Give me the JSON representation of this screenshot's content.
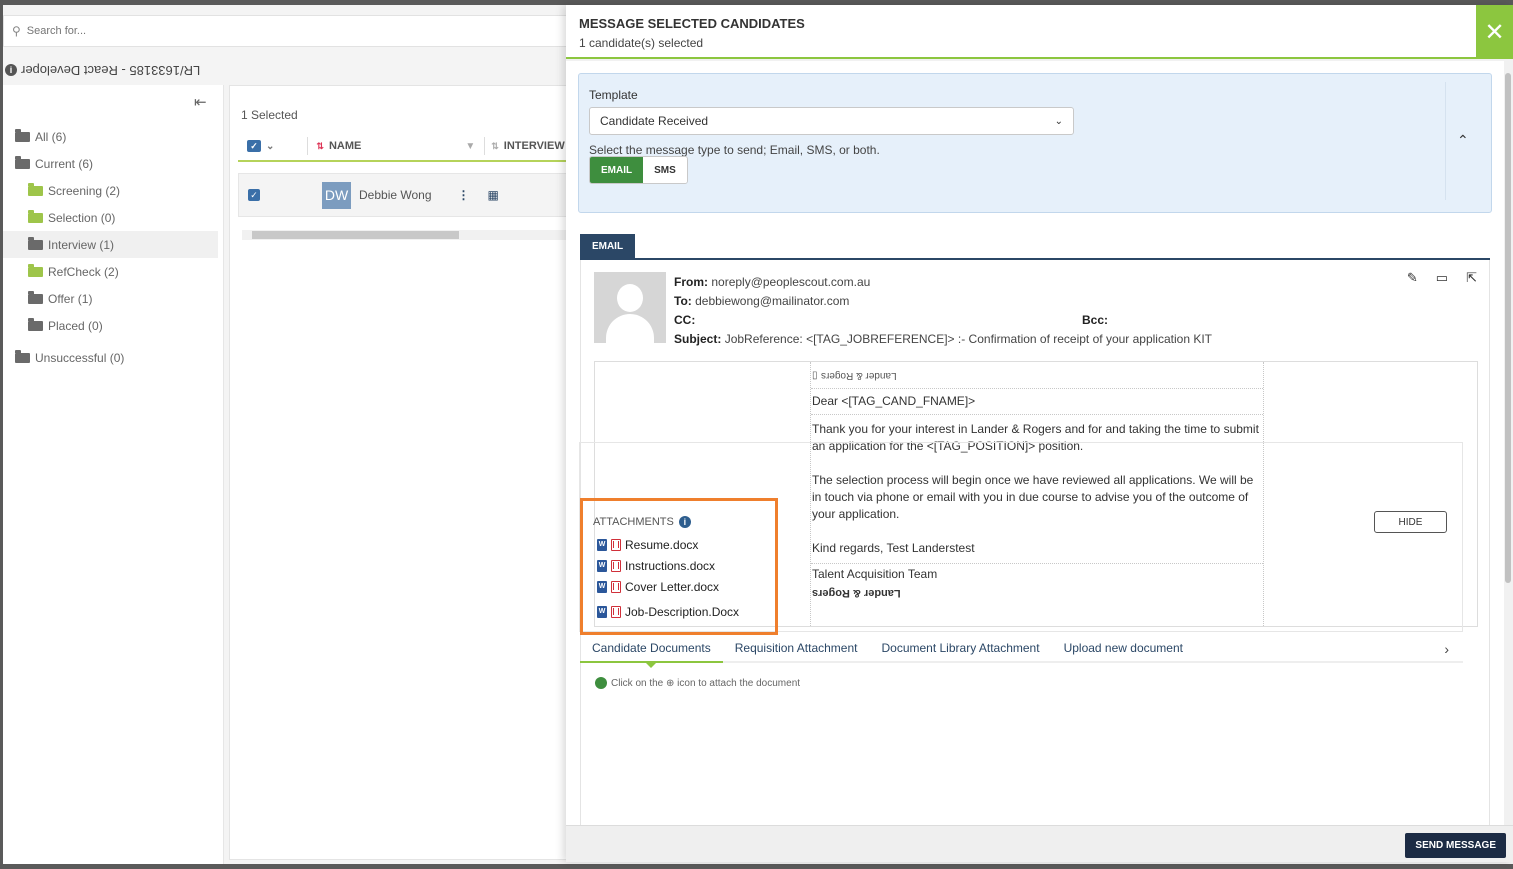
{
  "background": {
    "search_placeholder": "Search for...",
    "job_title": "LR/1633185 - React Developer",
    "folders": [
      {
        "label": "All (6)",
        "level": 0,
        "color": "gray"
      },
      {
        "label": "Current (6)",
        "level": 0,
        "color": "gray"
      },
      {
        "label": "Screening (2)",
        "level": 1,
        "color": "green"
      },
      {
        "label": "Selection (0)",
        "level": 1,
        "color": "green"
      },
      {
        "label": "Interview (1)",
        "level": 1,
        "color": "gray",
        "active": true
      },
      {
        "label": "RefCheck (2)",
        "level": 1,
        "color": "green"
      },
      {
        "label": "Offer (1)",
        "level": 1,
        "color": "gray"
      },
      {
        "label": "Placed (0)",
        "level": 1,
        "color": "gray"
      },
      {
        "label": "Unsuccessful (0)",
        "level": 0,
        "color": "gray"
      }
    ],
    "grid": {
      "selected_count": "1 Selected",
      "col_name": "NAME",
      "col_interview": "INTERVIEW",
      "row": {
        "initials": "DW",
        "name": "Debbie Wong"
      }
    }
  },
  "modal": {
    "title": "MESSAGE SELECTED CANDIDATES",
    "subtitle": "1 candidate(s) selected",
    "close_icon": "close-icon",
    "template": {
      "label": "Template",
      "selected": "Candidate Received",
      "help": "Select the message type to send; Email, SMS, or both.",
      "types": [
        "EMAIL",
        "SMS"
      ],
      "active_type": "EMAIL"
    },
    "email_tab": "EMAIL",
    "email": {
      "from_label": "From:",
      "from": "noreply@peoplescout.com.au",
      "to_label": "To:",
      "to": "debbiewong@mailinator.com",
      "cc_label": "CC:",
      "bcc_label": "Bcc:",
      "subject_label": "Subject:",
      "subject": "JobReference: <[TAG_JOBREFERENCE]> :- Confirmation of receipt of your application KIT",
      "header_logo_alt": "Lander & Rogers",
      "greeting": "Dear <[TAG_CAND_FNAME]>",
      "para1": "Thank you for your interest in Lander & Rogers and for and taking the time to submit an application for the <[TAG_POSITION]> position.",
      "para2": "The selection process will begin once we have reviewed all applications. We will be in touch via phone or email with you in due course to advise you of the outcome of your application.",
      "sign_off": "Kind regards, Test Landerstest",
      "team": "Talent Acquisition Team",
      "footer_logo": "Lander & Rogers"
    },
    "attachments": {
      "title": "ATTACHMENTS",
      "hide_label": "HIDE",
      "files": [
        "Resume.docx",
        "Instructions.docx",
        "Cover Letter.docx",
        "Job-Description.Docx"
      ]
    },
    "doc_tabs": [
      "Candidate Documents",
      "Requisition Attachment",
      "Document Library Attachment",
      "Upload new document"
    ],
    "active_doc_tab": "Candidate Documents",
    "doc_hint": "Click on the  ⊕  icon to attach the document",
    "send_label": "SEND MESSAGE"
  },
  "colors": {
    "accent_green": "#8cc63f",
    "navy": "#2b4766",
    "highlight_orange": "#ef7f2d",
    "email_btn_green": "#3e8e3e"
  }
}
